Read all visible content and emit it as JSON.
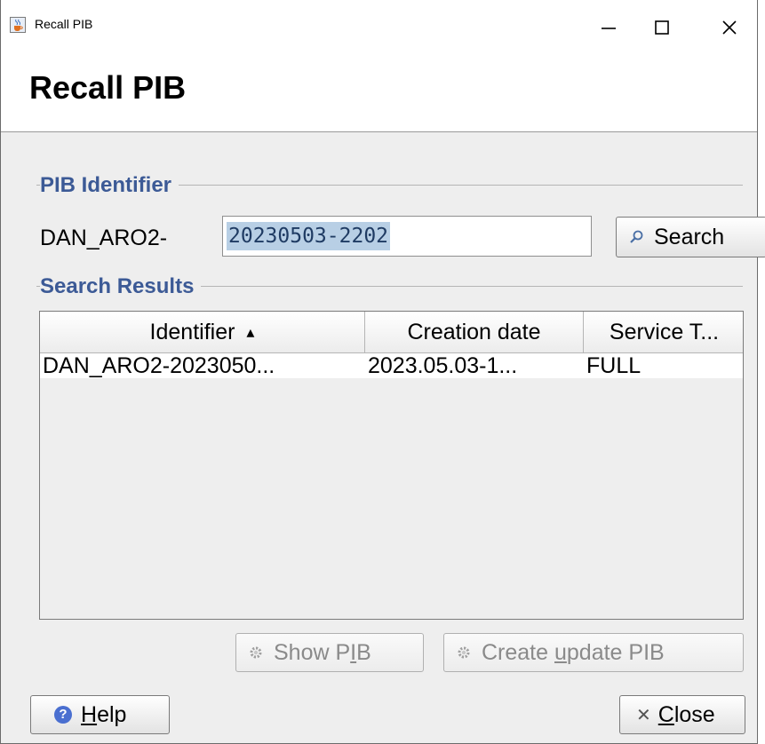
{
  "window": {
    "title": "Recall PIB",
    "minimize_symbol": "—",
    "maximize_symbol": "☐",
    "close_symbol": "✕"
  },
  "header": {
    "title": "Recall PIB"
  },
  "pib_identifier": {
    "section_title": "PIB Identifier",
    "prefix": "DAN_ARO2-",
    "input_value": "20230503-2202",
    "search_button_label": "Search"
  },
  "results": {
    "section_title": "Search Results",
    "columns": [
      {
        "label": "Identifier",
        "sort": "ascending"
      },
      {
        "label": "Creation date"
      },
      {
        "label": "Service T..."
      }
    ],
    "sort_indicator": "▴",
    "rows": [
      [
        "DAN_ARO2-2023050...",
        "2023.05.03-1...",
        "FULL"
      ]
    ]
  },
  "actions": {
    "show_pib": {
      "before": "Show P",
      "mnemonic": "I",
      "after": "B"
    },
    "create_update": {
      "before": "Create ",
      "mnemonic": "u",
      "after": "pdate PIB"
    }
  },
  "footer": {
    "help": {
      "icon_text": "?",
      "mnemonic": "H",
      "rest": "elp"
    },
    "close": {
      "icon_text": "✕",
      "mnemonic": "C",
      "rest": "lose"
    }
  },
  "colors": {
    "section_title": "#3c5a96",
    "selection": "#b8cfe5",
    "dialog_bg": "#eeeeee",
    "help_icon": "#4a6fd0"
  },
  "icons": {
    "app": "java-cup-icon",
    "search": "magnifier-icon",
    "show_pib": "gear-icon",
    "create_update": "gear-icon",
    "help": "question-icon",
    "close": "close-x-icon"
  }
}
